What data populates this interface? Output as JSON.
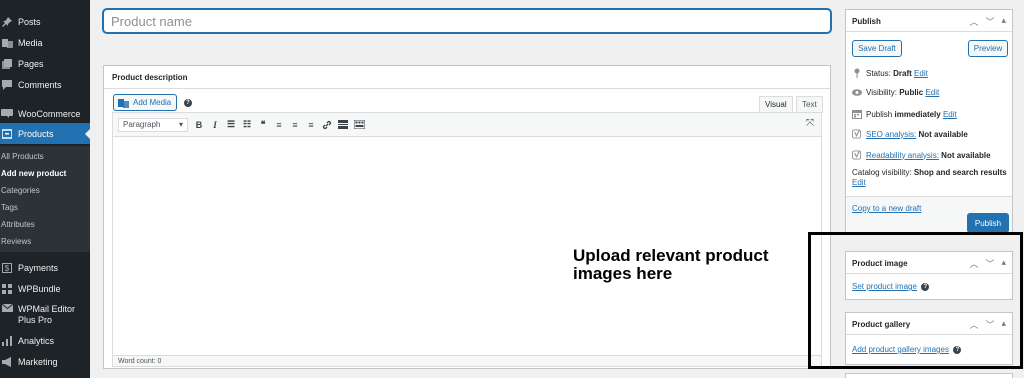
{
  "sidebar": {
    "menu": [
      {
        "label": "Posts",
        "icon": "pushpin-icon"
      },
      {
        "label": "Media",
        "icon": "media-icon"
      },
      {
        "label": "Pages",
        "icon": "pages-icon"
      },
      {
        "label": "Comments",
        "icon": "comments-icon"
      },
      {
        "label": "WooCommerce",
        "icon": "woocommerce-icon"
      },
      {
        "label": "Products",
        "icon": "archive-icon"
      },
      {
        "label": "Payments",
        "icon": "payments-icon"
      },
      {
        "label": "WPBundle",
        "icon": "grid-icon"
      },
      {
        "label": "WPMail Editor Plus Pro",
        "icon": "mail-icon"
      },
      {
        "label": "Analytics",
        "icon": "analytics-icon"
      },
      {
        "label": "Marketing",
        "icon": "megaphone-icon"
      }
    ],
    "submenu": [
      "All Products",
      "Add new product",
      "Categories",
      "Tags",
      "Attributes",
      "Reviews"
    ]
  },
  "title_field": {
    "placeholder": "Product name"
  },
  "description": {
    "title": "Product description",
    "add_media": "Add Media",
    "tab_visual": "Visual",
    "tab_text": "Text",
    "format": "Paragraph",
    "word_count": "Word count: 0"
  },
  "annotation": "Upload relevant product images here",
  "publish": {
    "title": "Publish",
    "save_draft": "Save Draft",
    "preview": "Preview",
    "status_label": "Status:",
    "status_value": "Draft",
    "visibility_label": "Visibility:",
    "visibility_value": "Public",
    "publish_label": "Publish",
    "publish_value": "immediately",
    "edit": "Edit",
    "seo_link": "SEO analysis:",
    "seo_value": "Not available",
    "readability_link": "Readability analysis:",
    "readability_value": "Not available",
    "catalog_label": "Catalog visibility:",
    "catalog_value": "Shop and search results",
    "copy_draft": "Copy to a new draft",
    "publish_button": "Publish"
  },
  "product_image": {
    "title": "Product image",
    "link": "Set product image"
  },
  "product_gallery": {
    "title": "Product gallery",
    "link": "Add product gallery images"
  },
  "colors": {
    "accent": "#2271b1",
    "sidebar": "#1d2327",
    "background": "#f0f0f1"
  }
}
